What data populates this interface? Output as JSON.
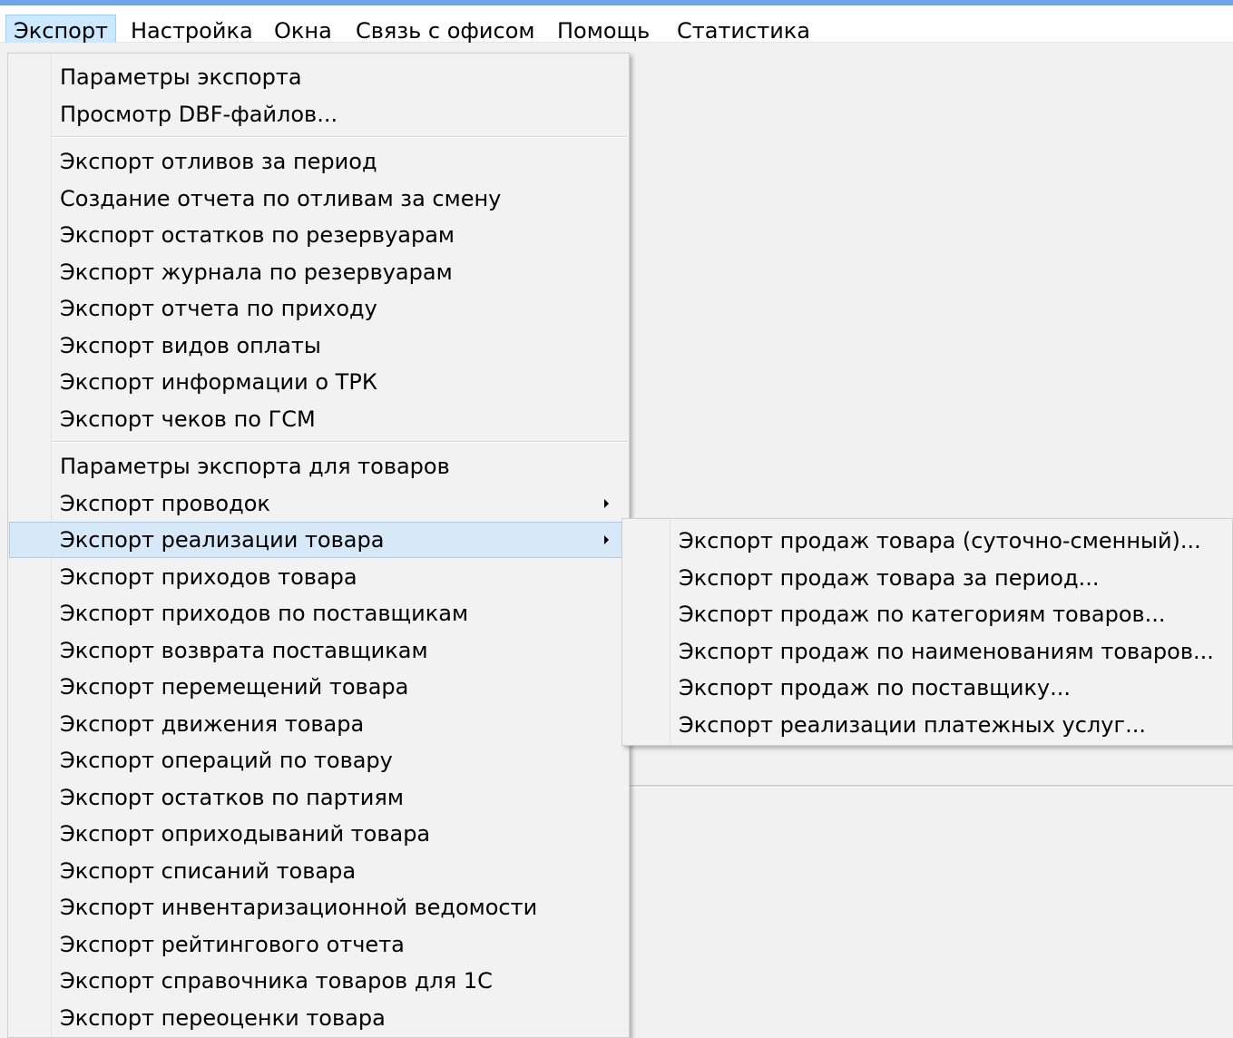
{
  "menubar": {
    "items": [
      {
        "label": "Экспорт",
        "active": true
      },
      {
        "label": "Настройка"
      },
      {
        "label": "Окна"
      },
      {
        "label": "Связь с офисом"
      },
      {
        "label": "Помощь"
      },
      {
        "label": "Статистика"
      }
    ]
  },
  "export_menu": {
    "groups": [
      [
        {
          "label": "Параметры экспорта"
        },
        {
          "label": "Просмотр DBF-файлов..."
        }
      ],
      [
        {
          "label": "Экспорт отливов за период"
        },
        {
          "label": "Создание отчета по отливам за смену"
        },
        {
          "label": "Экспорт остатков по резервуарам"
        },
        {
          "label": "Экспорт журнала по резервуарам"
        },
        {
          "label": "Экспорт отчета по приходу"
        },
        {
          "label": "Экспорт видов оплаты"
        },
        {
          "label": "Экспорт информации о ТРК"
        },
        {
          "label": "Экспорт чеков по ГСМ"
        }
      ],
      [
        {
          "label": "Параметры экспорта для товаров"
        },
        {
          "label": "Экспорт проводок",
          "submenu": true
        },
        {
          "label": "Экспорт реализации товара",
          "submenu": true,
          "highlighted": true
        },
        {
          "label": "Экспорт приходов товара"
        },
        {
          "label": "Экспорт приходов по поставщикам"
        },
        {
          "label": "Экспорт возврата поставщикам"
        },
        {
          "label": "Экспорт перемещений товара"
        },
        {
          "label": "Экспорт движения товара"
        },
        {
          "label": "Экспорт операций по товару"
        },
        {
          "label": "Экспорт остатков по партиям"
        },
        {
          "label": "Экспорт оприходываний товара"
        },
        {
          "label": "Экспорт списаний товара"
        },
        {
          "label": "Экспорт инвентаризационной ведомости"
        },
        {
          "label": "Экспорт рейтингового отчета"
        },
        {
          "label": "Экспорт справочника товаров для 1С"
        },
        {
          "label": "Экспорт переоценки товара"
        }
      ]
    ]
  },
  "sales_submenu": {
    "items": [
      {
        "label": "Экспорт продаж товара (суточно-сменный)..."
      },
      {
        "label": "Экспорт продаж товара за период..."
      },
      {
        "label": "Экспорт продаж по категориям товаров..."
      },
      {
        "label": "Экспорт продаж по наименованиям товаров..."
      },
      {
        "label": "Экспорт продаж по поставщику..."
      },
      {
        "label": "Экспорт реализации платежных услуг..."
      }
    ]
  },
  "colors": {
    "title_strip": "#6fa5e6",
    "menubar_active_bg": "#cce8ff",
    "menu_highlight_bg": "#d7e8f8",
    "menu_bg": "#f2f2f2"
  }
}
